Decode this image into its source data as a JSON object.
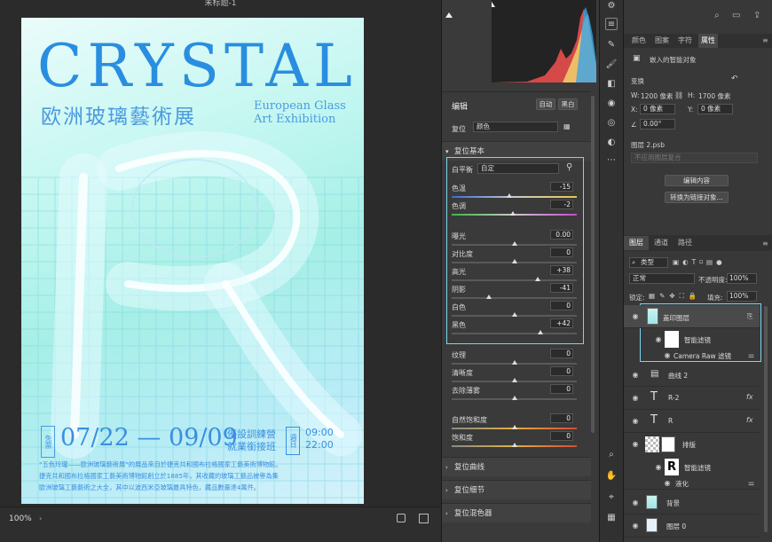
{
  "document": {
    "title": "未标题-1",
    "zoom": "100%"
  },
  "poster": {
    "headline": "CRYSTAL",
    "zh_title": "欧洲玻璃藝術展",
    "en_subtitle_line1": "European Glass",
    "en_subtitle_line2": "Art Exhibition",
    "ticket": "免票",
    "dates": "07/22 — 09/09",
    "event_line1": "優設訓練營",
    "event_line2": "就業銜接班",
    "weekday": "週日",
    "time_start": "09:00",
    "time_end": "22:00",
    "body_line1": "“五色玲瓏——歐洲玻璃藝術展”的展品來自於捷克共和國布拉格國家工藝美術博物館。",
    "body_line2": "捷克共和國布拉格國家工藝美術博物館創立於1885年，其收藏的玻璃工藝品被譽為集",
    "body_line3": "歐洲玻璃工藝藝術之大全，其中以波西米亞玻璃最具特色，藏品數量達4萬件。"
  },
  "camera_raw": {
    "edit_label": "编辑",
    "auto_button": "自动",
    "bw_button": "黑白",
    "reset_label": "复位",
    "profile_value": "颜色",
    "basic_section": "复位基本",
    "wb_label": "白平衡",
    "wb_value": "自定",
    "sliders": [
      {
        "label": "色温",
        "value": "-15",
        "pos": 0.46
      },
      {
        "label": "色调",
        "value": "-2",
        "pos": 0.49
      },
      {
        "label": "曝光",
        "value": "0.00",
        "pos": 0.5
      },
      {
        "label": "对比度",
        "value": "0",
        "pos": 0.5
      },
      {
        "label": "高光",
        "value": "+38",
        "pos": 0.69
      },
      {
        "label": "阴影",
        "value": "-41",
        "pos": 0.3
      },
      {
        "label": "白色",
        "value": "0",
        "pos": 0.5
      },
      {
        "label": "黑色",
        "value": "+42",
        "pos": 0.71
      }
    ],
    "sliders2": [
      {
        "label": "纹理",
        "value": "0",
        "pos": 0.5
      },
      {
        "label": "清晰度",
        "value": "0",
        "pos": 0.5
      },
      {
        "label": "去除薄雾",
        "value": "0",
        "pos": 0.5
      }
    ],
    "sliders3": [
      {
        "label": "自然饱和度",
        "value": "0",
        "pos": 0.5
      },
      {
        "label": "饱和度",
        "value": "0",
        "pos": 0.5
      }
    ],
    "curve_section": "复位曲线",
    "detail_section": "复位细节",
    "mixer_section": "复位混色器"
  },
  "properties": {
    "tabs": [
      "颜色",
      "图案",
      "字符",
      "属性"
    ],
    "active_tab": "属性",
    "type_label": "嵌入的智能对象",
    "transform_label": "变换",
    "w_label": "W:",
    "w_value": "1200 像素",
    "h_label": "H:",
    "h_value": "1700 像素",
    "x_label": "X:",
    "x_value": "0 像素",
    "y_label": "Y:",
    "y_value": "0 像素",
    "angle_value": "0.00°",
    "file_name": "图层 2.psb",
    "comp_placeholder": "不应用图层复合",
    "edit_contents_button": "编辑内容",
    "convert_link_button": "转换为链接对象..."
  },
  "layers_panel": {
    "tabs": [
      "图层",
      "通道",
      "路径"
    ],
    "filter_label": "类型",
    "blend_mode": "正常",
    "opacity_label": "不透明度:",
    "opacity_value": "100%",
    "lock_label": "锁定:",
    "fill_label": "填充:",
    "fill_value": "100%",
    "layers": [
      {
        "name": "盖印图层"
      },
      {
        "name": "智能滤镜"
      },
      {
        "name": "Camera Raw 滤镜"
      },
      {
        "name": "曲线 2"
      },
      {
        "name": "R-2"
      },
      {
        "name": "R"
      },
      {
        "name": "排版"
      },
      {
        "name": "智能滤镜"
      },
      {
        "name": "液化"
      },
      {
        "name": "背景"
      },
      {
        "name": "图层 0"
      }
    ]
  },
  "colors": {
    "accent": "#2a8ee0",
    "highlight": "#7fd3f0"
  }
}
